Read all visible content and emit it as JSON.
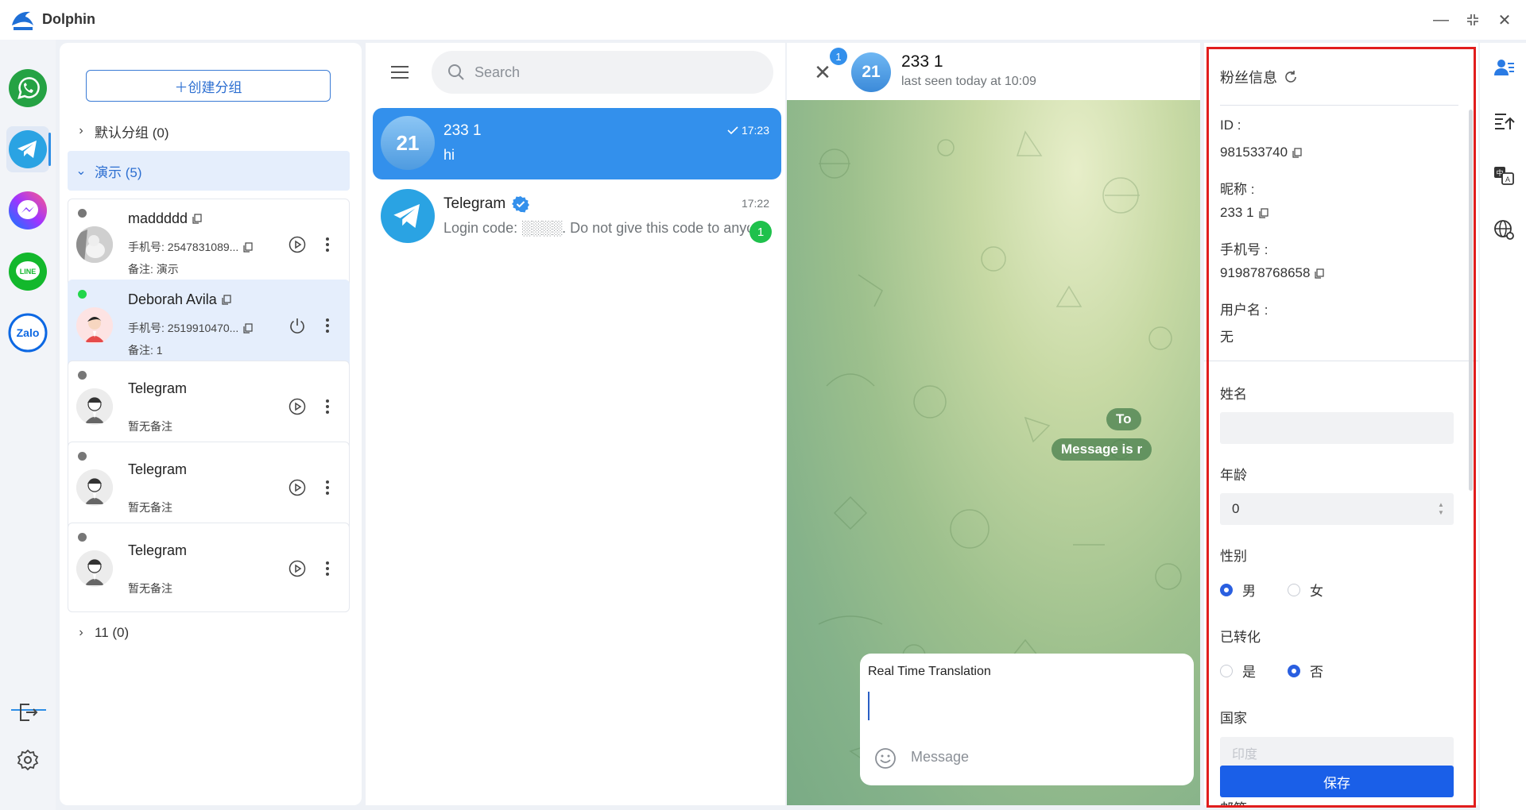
{
  "app": {
    "name": "Dolphin"
  },
  "colors": {
    "accent": "#3390ec",
    "brand_blue": "#2d6fd1",
    "online": "#22d64a",
    "danger_border": "#e11d1d",
    "save": "#1a5fe8"
  },
  "rail": {
    "items": [
      {
        "icon": "whatsapp-icon"
      },
      {
        "icon": "telegram-icon",
        "active": true
      },
      {
        "icon": "messenger-icon"
      },
      {
        "icon": "line-icon",
        "label": "LINE"
      },
      {
        "icon": "zalo-icon",
        "label": "Zalo"
      }
    ],
    "bottom": [
      {
        "icon": "logout-icon"
      },
      {
        "icon": "settings-icon"
      }
    ]
  },
  "groups": {
    "create_label": "＋创建分组",
    "default_group": "默认分组 (0)",
    "demo_group": "演示 (5)",
    "other_group": "11 (0)",
    "accounts": [
      {
        "name": "maddddd",
        "phone": "手机号: 2547831089...",
        "note": "备注: 演示",
        "online": false,
        "action": "play"
      },
      {
        "name": "Deborah Avila",
        "phone": "手机号: 2519910470...",
        "note": "备注: 1",
        "online": true,
        "action": "power"
      },
      {
        "name": "Telegram",
        "note": "暂无备注",
        "online": false,
        "action": "play"
      },
      {
        "name": "Telegram",
        "note": "暂无备注",
        "online": false,
        "action": "play"
      },
      {
        "name": "Telegram",
        "note": "暂无备注",
        "online": false,
        "action": "play"
      }
    ]
  },
  "chatlist": {
    "search_placeholder": "Search",
    "chats": [
      {
        "avatar_text": "21",
        "title": "233 1",
        "message": "hi",
        "time": "17:23",
        "read": true
      },
      {
        "title": "Telegram",
        "verified": true,
        "message": "Login code: ░░░░. Do not give this code to anyone",
        "time": "17:22",
        "unread": "1"
      }
    ]
  },
  "conversation": {
    "unread_count": "1",
    "avatar_text": "21",
    "name": "233 1",
    "last_seen": "last seen today at 10:09",
    "pills": [
      "To",
      "Message is r"
    ],
    "compose": {
      "translation_label": "Real Time Translation",
      "placeholder": "Message"
    }
  },
  "fan": {
    "title": "粉丝信息",
    "id_label": "ID :",
    "id_value": "981533740",
    "nickname_label": "昵称 :",
    "nickname_value": "233 1",
    "phone_label": "手机号 :",
    "phone_value": "919878768658",
    "username_label": "用户名 :",
    "username_value": "无",
    "surname_label": "姓名",
    "surname_value": "",
    "age_label": "年龄",
    "age_value": "0",
    "gender_label": "性别",
    "gender_options": [
      "男",
      "女"
    ],
    "gender_selected": "男",
    "converted_label": "已转化",
    "converted_options": [
      "是",
      "否"
    ],
    "converted_selected": "否",
    "country_label": "国家",
    "country_value": "印度",
    "save_label": "保存",
    "next_label": "邮箱"
  }
}
